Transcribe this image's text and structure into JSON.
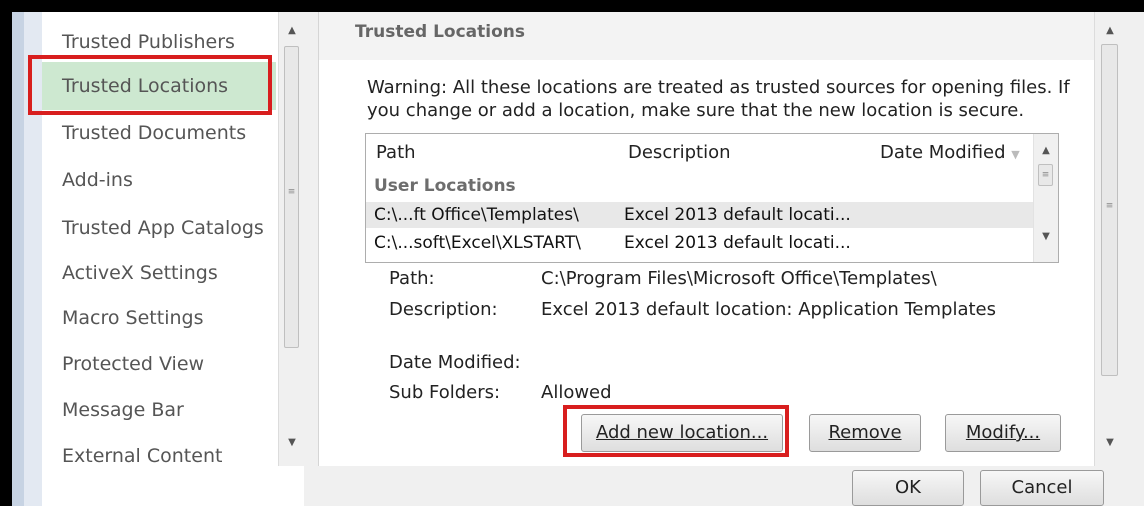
{
  "nav": {
    "items": [
      {
        "label": "Trusted Publishers"
      },
      {
        "label": "Trusted Locations",
        "selected": true
      },
      {
        "label": "Trusted Documents"
      },
      {
        "label": "Add-ins"
      },
      {
        "label": "Trusted App Catalogs"
      },
      {
        "label": "ActiveX Settings"
      },
      {
        "label": "Macro Settings"
      },
      {
        "label": "Protected View"
      },
      {
        "label": "Message Bar"
      },
      {
        "label": "External Content"
      }
    ]
  },
  "section": {
    "title": "Trusted Locations",
    "warning": "Warning: All these locations are treated as trusted sources for opening files.  If you change or add a location, make sure that the new location is secure."
  },
  "table": {
    "columns": [
      "Path",
      "Description",
      "Date Modified"
    ],
    "group_label": "User Locations",
    "rows": [
      {
        "path": "C:\\...ft Office\\Templates\\",
        "description": "Excel 2013 default locati...",
        "selected": true
      },
      {
        "path": "C:\\...soft\\Excel\\XLSTART\\",
        "description": "Excel 2013 default locati..."
      }
    ]
  },
  "details": {
    "path_label": "Path:",
    "path_value": "C:\\Program Files\\Microsoft Office\\Templates\\",
    "description_label": "Description:",
    "description_value": "Excel 2013 default location: Application Templates",
    "date_label": "Date Modified:",
    "subfolders_label": "Sub Folders:",
    "subfolders_value": "Allowed"
  },
  "buttons": {
    "add_new_location": "Add new location...",
    "remove": "Remove",
    "modify": "Modify...",
    "ok": "OK",
    "cancel": "Cancel"
  },
  "colors": {
    "selected_nav_bg": "#cde8d0",
    "highlight_red": "#d81e1e"
  }
}
